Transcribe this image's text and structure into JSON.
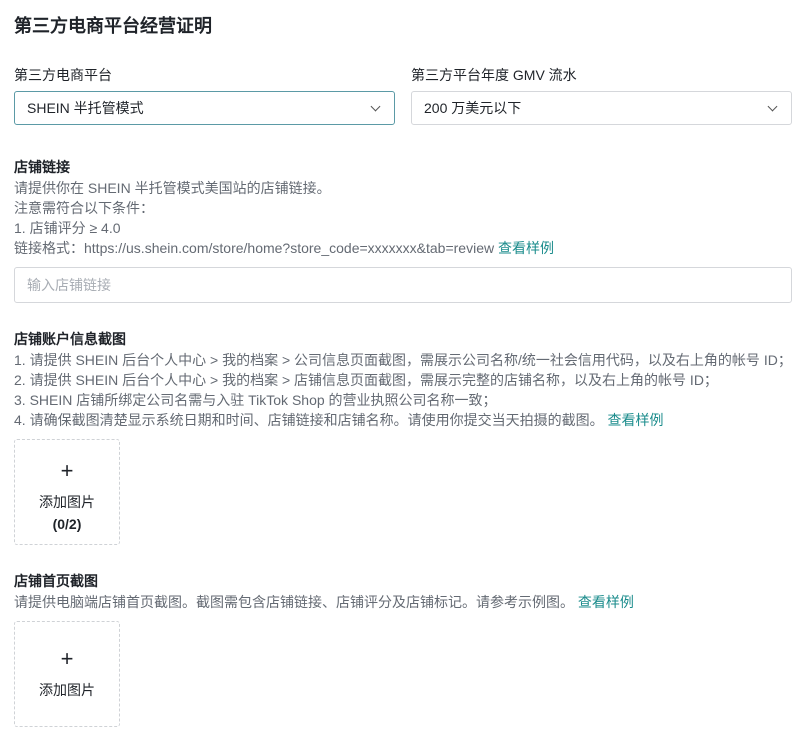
{
  "page": {
    "title": "第三方电商平台经营证明"
  },
  "platform": {
    "label": "第三方电商平台",
    "selected": "SHEIN 半托管模式",
    "icon": "chevron-down-icon"
  },
  "gmv": {
    "label": "第三方平台年度 GMV 流水",
    "selected": "200 万美元以下",
    "icon": "chevron-down-icon"
  },
  "store_link": {
    "title": "店铺链接",
    "lines": [
      "请提供你在 SHEIN 半托管模式美国站的店铺链接。",
      "注意需符合以下条件：",
      "1. 店铺评分 ≥ 4.0",
      "链接格式：https://us.shein.com/store/home?store_code=xxxxxxx&tab=review"
    ],
    "example_link": "查看样例",
    "input_placeholder": "输入店铺链接",
    "input_value": ""
  },
  "account_screenshot": {
    "title": "店铺账户信息截图",
    "lines": [
      "1. 请提供 SHEIN 后台个人中心 > 我的档案 > 公司信息页面截图，需展示公司名称/统一社会信用代码，以及右上角的帐号 ID；",
      "2. 请提供 SHEIN 后台个人中心 > 我的档案 > 店铺信息页面截图，需展示完整的店铺名称，以及右上角的帐号 ID；",
      "3. SHEIN 店铺所绑定公司名需与入驻 TikTok Shop 的营业执照公司名称一致；",
      "4. 请确保截图清楚显示系统日期和时间、店铺链接和店铺名称。请使用你提交当天拍摄的截图。"
    ],
    "example_link": "查看样例",
    "upload_label": "添加图片",
    "upload_count": "(0/2)"
  },
  "homepage_screenshot": {
    "title": "店铺首页截图",
    "line": "请提供电脑端店铺首页截图。截图需包含店铺链接、店铺评分及店铺标记。请参考示例图。",
    "example_link": "查看样例",
    "upload_label": "添加图片"
  },
  "colors": {
    "accent": "#1b8c8c",
    "focus_border": "#5b9aa6",
    "muted_text": "#646a73"
  }
}
